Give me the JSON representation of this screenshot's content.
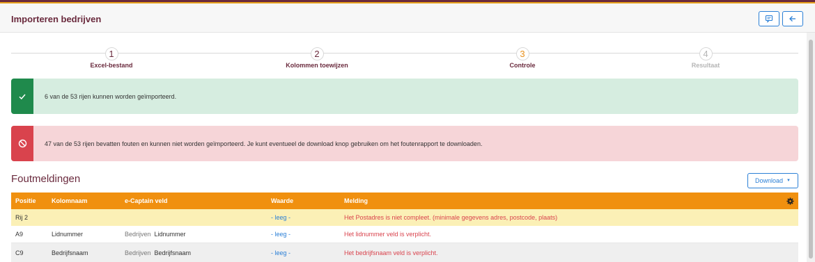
{
  "header": {
    "title": "Importeren bedrijven",
    "buttons": [
      {
        "icon": "comment-icon"
      },
      {
        "icon": "arrow-left-icon"
      }
    ]
  },
  "stepper": {
    "steps": [
      {
        "number": "1",
        "label": "Excel-bestand",
        "state": "done"
      },
      {
        "number": "2",
        "label": "Kolommen toewijzen",
        "state": "done"
      },
      {
        "number": "3",
        "label": "Controle",
        "state": "current"
      },
      {
        "number": "4",
        "label": "Resultaat",
        "state": "future"
      }
    ]
  },
  "alerts": {
    "success": {
      "icon": "check-icon",
      "text": "6 van de 53 rijen kunnen worden geïmporteerd."
    },
    "danger": {
      "icon": "ban-icon",
      "text": "47 van de 53 rijen bevatten fouten en kunnen niet worden geïmporteerd. Je kunt eventueel de download knop gebruiken om het foutenrapport te downloaden."
    }
  },
  "errors": {
    "title": "Foutmeldingen",
    "download_label": "Download",
    "columns": [
      "Positie",
      "Kolomnaam",
      "e-Captain veld",
      "Waarde",
      "Melding"
    ],
    "settings_icon": "gear-icon",
    "rows": [
      {
        "positie": "Rij 2",
        "kolomnaam": "",
        "veld_prefix": "",
        "veld": "",
        "waarde": "- leeg -",
        "melding": "Het Postadres is niet compleet. (minimale gegevens adres, postcode, plaats)"
      },
      {
        "positie": "A9",
        "kolomnaam": "Lidnummer",
        "veld_prefix": "Bedrijven",
        "veld": "Lidnummer",
        "waarde": "- leeg -",
        "melding": "Het lidnummer veld is verplicht."
      },
      {
        "positie": "C9",
        "kolomnaam": "Bedrijfsnaam",
        "veld_prefix": "Bedrijven",
        "veld": "Bedrijfsnaam",
        "waarde": "- leeg -",
        "melding": "Het bedrijfsnaam veld is verplicht."
      }
    ]
  },
  "colors": {
    "brand": "#6a2a3d",
    "accent": "#e8a11c",
    "table_header": "#f0900f",
    "success": "#1f8a4c",
    "danger": "#d9434d",
    "link": "#2a7fd6"
  }
}
